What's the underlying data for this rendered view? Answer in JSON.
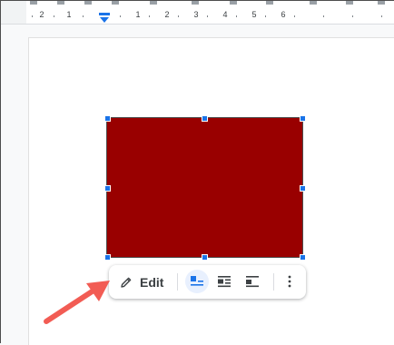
{
  "ruler": {
    "numbers": [
      "2",
      "1",
      "1",
      "2",
      "3",
      "4",
      "5",
      "6"
    ]
  },
  "image": {
    "fill_color": "#990000",
    "selected": true
  },
  "toolbar": {
    "edit_label": "Edit",
    "edit_icon": "pencil-icon",
    "buttons": [
      {
        "name": "inline-with-text",
        "icon": "wrap-inline-icon",
        "active": true
      },
      {
        "name": "wrap-text",
        "icon": "wrap-text-icon",
        "active": false
      },
      {
        "name": "break-text",
        "icon": "break-text-icon",
        "active": false
      },
      {
        "name": "more-options",
        "icon": "more-vert-icon",
        "active": false
      }
    ]
  },
  "colors": {
    "accent": "#1a73e8",
    "annotation_arrow": "#f25c54"
  }
}
